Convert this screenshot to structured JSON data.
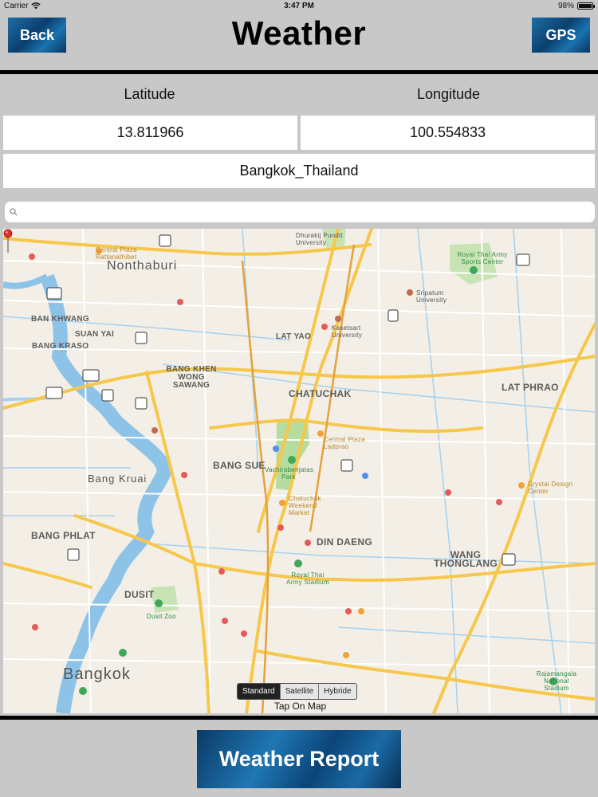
{
  "status_bar": {
    "carrier": "Carrier",
    "time": "3:47 PM",
    "battery": "98%"
  },
  "nav": {
    "back_label": "Back",
    "title": "Weather",
    "gps_label": "GPS"
  },
  "coords": {
    "latitude_label": "Latitude",
    "longitude_label": "Longitude",
    "latitude_value": "13.811966",
    "longitude_value": "100.554833",
    "location_value": "Bangkok_Thailand"
  },
  "search": {
    "placeholder": ""
  },
  "map": {
    "labels": [
      {
        "text": "Nonthaburi"
      },
      {
        "text": "Bangkok"
      },
      {
        "text": "Bang Kruai"
      },
      {
        "text": "CHATUCHAK"
      },
      {
        "text": "BANG SUE"
      },
      {
        "text": "DIN DAENG"
      },
      {
        "text": "LAT PHRAO"
      },
      {
        "text": "WANG THONGLANG"
      },
      {
        "text": "DUSIT"
      },
      {
        "text": "BANG PHLAT"
      },
      {
        "text": "LAT YAO"
      },
      {
        "text": "BAN KHWANG"
      },
      {
        "text": "BANG KHEN WONG SAWANG"
      },
      {
        "text": "SUAN YAI"
      },
      {
        "text": "BANG KRASO"
      },
      {
        "text": "Vachirabenjatas Park"
      },
      {
        "text": "Chatuchak Weekend Market"
      },
      {
        "text": "Central Plaza Ladprao"
      },
      {
        "text": "Kasetsart University"
      },
      {
        "text": "Royal Thai Army Stadium"
      },
      {
        "text": "Dusit Zoo"
      },
      {
        "text": "Crystal Design Center"
      },
      {
        "text": "Royal Thai Army Sports Center"
      },
      {
        "text": "Sripatum University"
      },
      {
        "text": "Dhurakij Pundit University"
      },
      {
        "text": "Central Plaza Rattanathibet"
      },
      {
        "text": "Rajamangala National Stadium"
      }
    ],
    "type_options": [
      "Standard",
      "Satellite",
      "Hybride"
    ],
    "selected_type": "Standard",
    "tap_hint": "Tap On Map"
  },
  "report_button_label": "Weather Report"
}
